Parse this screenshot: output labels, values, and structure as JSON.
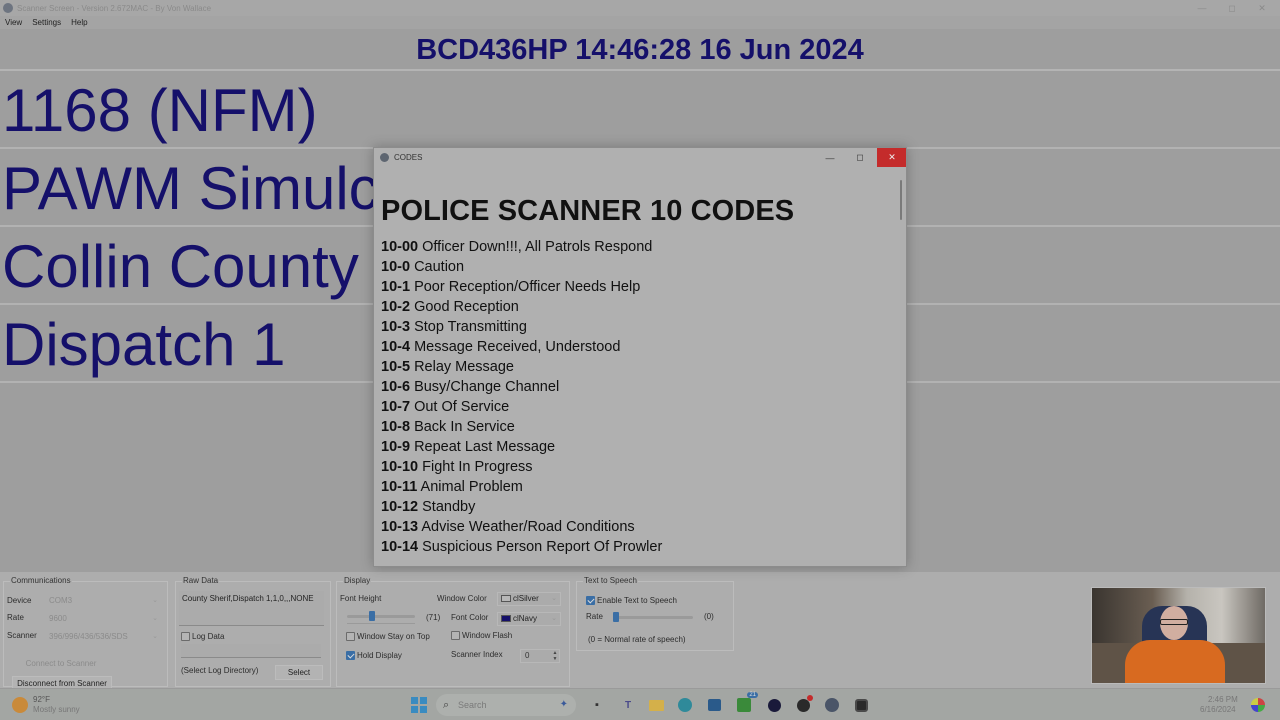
{
  "app": {
    "title": "Scanner Screen - Version 2.672MAC  - By Von Wallace",
    "window_controls": {
      "minimize": "—",
      "maximize": "◻",
      "close": "✕"
    },
    "menu": [
      "View",
      "Settings",
      "Help"
    ]
  },
  "display": {
    "header": "BCD436HP 14:46:28 16 Jun 2024",
    "lines": [
      "1168 (NFM)",
      "PAWM Simulcast",
      "Collin County Sheriff",
      "Dispatch 1"
    ],
    "window_color": "#9e9e9e",
    "font_color": "#15106a"
  },
  "codes_dialog": {
    "title": "CODES",
    "controls": {
      "minimize": "—",
      "maximize": "◻",
      "close": "✕"
    },
    "heading": "POLICE SCANNER 10 CODES",
    "codes": [
      {
        "code": "10-00",
        "meaning": "Officer Down!!!, All Patrols Respond"
      },
      {
        "code": "10-0",
        "meaning": "Caution"
      },
      {
        "code": "10-1",
        "meaning": "Poor Reception/Officer Needs Help"
      },
      {
        "code": "10-2",
        "meaning": "Good Reception"
      },
      {
        "code": "10-3",
        "meaning": "Stop Transmitting"
      },
      {
        "code": "10-4",
        "meaning": "Message Received, Understood"
      },
      {
        "code": "10-5",
        "meaning": "Relay Message"
      },
      {
        "code": "10-6",
        "meaning": "Busy/Change Channel"
      },
      {
        "code": "10-7",
        "meaning": "Out Of Service"
      },
      {
        "code": "10-8",
        "meaning": "Back In Service"
      },
      {
        "code": "10-9",
        "meaning": "Repeat Last Message"
      },
      {
        "code": "10-10",
        "meaning": "Fight In Progress"
      },
      {
        "code": "10-11",
        "meaning": "Animal Problem"
      },
      {
        "code": "10-12",
        "meaning": "Standby"
      },
      {
        "code": "10-13",
        "meaning": "Advise Weather/Road Conditions"
      },
      {
        "code": "10-14",
        "meaning": "Suspicious Person Report Of Prowler"
      }
    ]
  },
  "communications": {
    "group_label": "Communications",
    "device_label": "Device",
    "device_value": "COM3",
    "rate_label": "Rate",
    "rate_value": "9600",
    "scanner_label": "Scanner",
    "scanner_value": "396/996/436/536/SDS",
    "connect_button": "Connect to Scanner",
    "disconnect_button": "Disconnect from Scanner"
  },
  "raw_data": {
    "group_label": "Raw Data",
    "value": "County Sherif,Dispatch 1,1,0,,,NONE",
    "log_data_label": "Log Data",
    "log_data_checked": false,
    "log_dir_label": "(Select Log Directory)",
    "select_button": "Select"
  },
  "display_settings": {
    "group_label": "Display",
    "font_height_label": "Font Height",
    "font_height_value": "(71)",
    "font_height_fraction": 0.35,
    "window_color_label": "Window Color",
    "window_color_value": "clSilver",
    "window_color_swatch": "#b8b8b8",
    "font_color_label": "Font Color",
    "font_color_value": "clNavy",
    "font_color_swatch": "#15106a",
    "stay_on_top_label": "Window Stay on Top",
    "stay_on_top_checked": false,
    "window_flash_label": "Window Flash",
    "window_flash_checked": false,
    "hold_display_label": "Hold Display",
    "hold_display_checked": true,
    "scanner_index_label": "Scanner Index",
    "scanner_index_value": "0"
  },
  "text_to_speech": {
    "group_label": "Text to Speech",
    "enable_label": "Enable Text to Speech",
    "enable_checked": true,
    "rate_label": "Rate",
    "rate_value": "(0)",
    "rate_fraction": 0.0,
    "note": "(0 = Normal rate of speech)"
  },
  "taskbar": {
    "weather_temp": "92°F",
    "weather_desc": "Mostly sunny",
    "search_placeholder": "Search",
    "time": "2:46 PM",
    "date": "6/16/2024",
    "xbox_badge": "21",
    "apps": [
      "start",
      "search",
      "widgets",
      "task-view",
      "teams",
      "file-explorer",
      "edge",
      "store",
      "xbox",
      "app-arrow",
      "obs",
      "scanner-app",
      "other-app"
    ]
  }
}
